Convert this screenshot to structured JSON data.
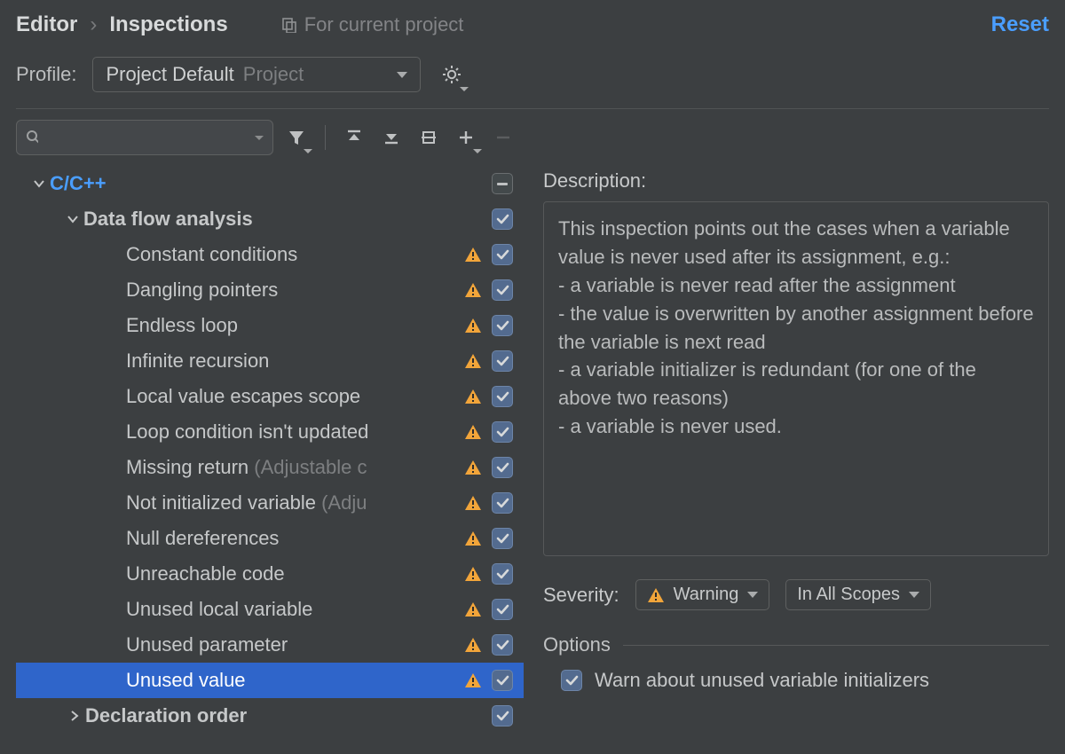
{
  "breadcrumb": {
    "a": "Editor",
    "sep": "›",
    "b": "Inspections"
  },
  "scope_hint": "For current project",
  "reset": "Reset",
  "profile": {
    "label": "Profile:",
    "name": "Project Default",
    "scope": "Project"
  },
  "search_placeholder": "",
  "tree": {
    "root": "C/C++",
    "group": "Data flow analysis",
    "items": [
      {
        "label": "Constant conditions",
        "suffix": ""
      },
      {
        "label": "Dangling pointers",
        "suffix": ""
      },
      {
        "label": "Endless loop",
        "suffix": ""
      },
      {
        "label": "Infinite recursion",
        "suffix": ""
      },
      {
        "label": "Local value escapes scope",
        "suffix": ""
      },
      {
        "label": "Loop condition isn't updated",
        "suffix": ""
      },
      {
        "label": "Missing return ",
        "suffix": "(Adjustable c"
      },
      {
        "label": "Not initialized variable ",
        "suffix": "(Adju"
      },
      {
        "label": "Null dereferences",
        "suffix": ""
      },
      {
        "label": "Unreachable code",
        "suffix": ""
      },
      {
        "label": "Unused local variable",
        "suffix": ""
      },
      {
        "label": "Unused parameter",
        "suffix": ""
      },
      {
        "label": "Unused value",
        "suffix": ""
      }
    ],
    "collapsed": "Declaration order"
  },
  "detail": {
    "title": "Description:",
    "body_l1": "This inspection points out the cases when a variable value is never used after its assignment, e.g.:",
    "body_b1": " - a variable is never read after the assignment",
    "body_b2": " - the value is overwritten by another assignment before the variable is next read",
    "body_b3": " - a variable initializer is redundant (for one of the above two reasons)",
    "body_b4": " - a variable is never used.",
    "severity_label": "Severity:",
    "severity_value": "Warning",
    "scope_value": "In All Scopes",
    "options_title": "Options",
    "option1": "Warn about unused variable initializers"
  }
}
